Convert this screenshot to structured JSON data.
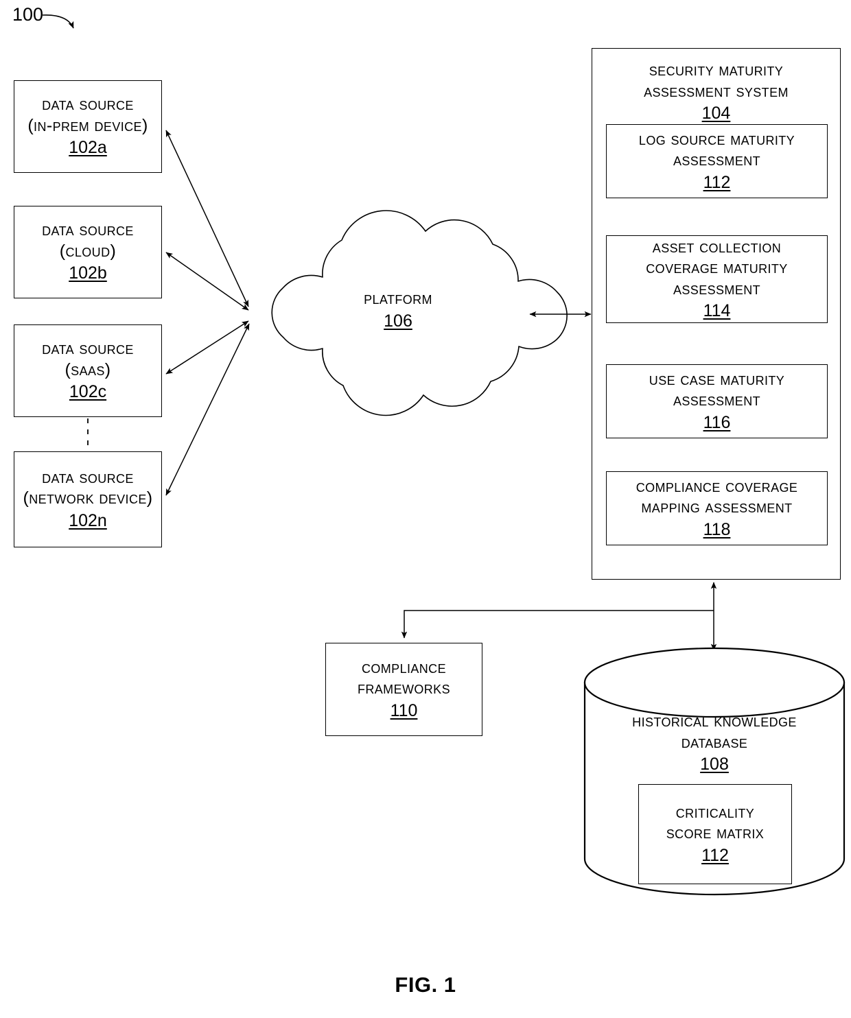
{
  "figure": {
    "number_label": "100",
    "caption": "FIG. 1"
  },
  "data_sources": [
    {
      "name": "Data Source\n(In-Prem Device)",
      "ref": "102a"
    },
    {
      "name": "Data Source\n(Cloud)",
      "ref": "102b"
    },
    {
      "name": "Data Source\n(SaaS)",
      "ref": "102c"
    },
    {
      "name": "Data Source\n(Network Device)",
      "ref": "102n"
    }
  ],
  "platform": {
    "name": "Platform",
    "ref": "106"
  },
  "system": {
    "name": "Security Maturity\nAssessment System",
    "ref": "104",
    "modules": [
      {
        "name": "Log Source Maturity\nAssessment",
        "ref": "112"
      },
      {
        "name": "Asset Collection\nCoverage Maturity\nAssessment",
        "ref": "114"
      },
      {
        "name": "Use Case Maturity\nAssessment",
        "ref": "116"
      },
      {
        "name": "Compliance Coverage\nMapping Assessment",
        "ref": "118"
      }
    ]
  },
  "compliance_frameworks": {
    "name": "Compliance\nFrameworks",
    "ref": "110"
  },
  "database": {
    "name": "Historical Knowledge\nDatabase",
    "ref": "108",
    "inner": {
      "name": "Criticality\nScore Matrix",
      "ref": "112"
    }
  },
  "colors": {
    "stroke": "#000000",
    "background": "#ffffff"
  }
}
